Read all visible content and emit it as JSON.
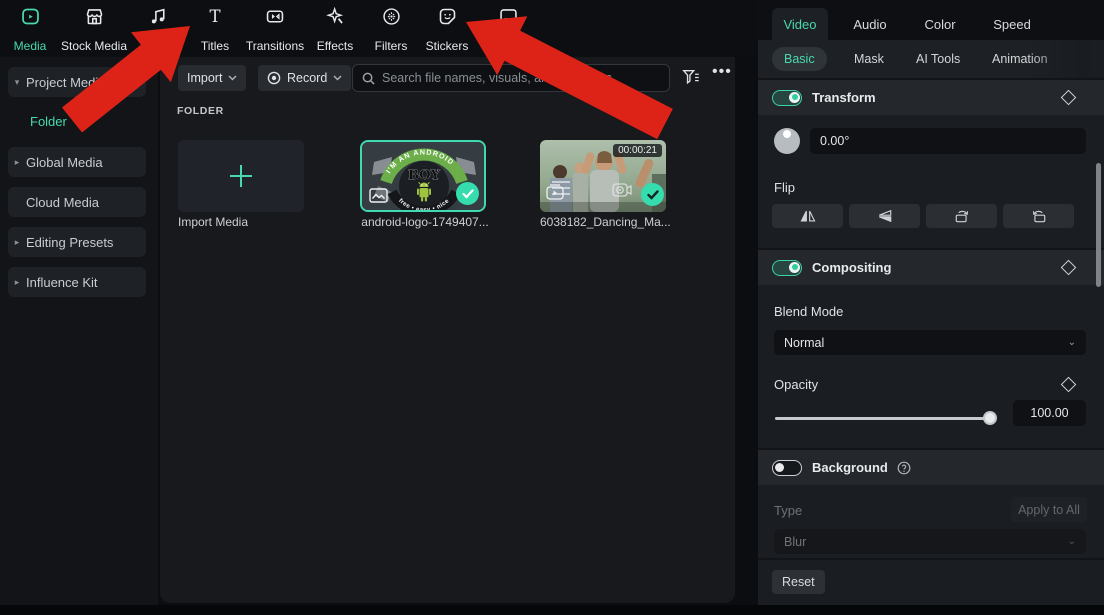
{
  "accent_color": "#49d9ae",
  "arrow_color": "#dd2317",
  "top_tabs": [
    {
      "label": "Media",
      "icon": "media-icon",
      "active": true
    },
    {
      "label": "Stock Media",
      "icon": "stock-media-icon"
    },
    {
      "label": "Audio",
      "icon": "audio-icon"
    },
    {
      "label": "Titles",
      "icon": "titles-icon"
    },
    {
      "label": "Transitions",
      "icon": "transitions-icon"
    },
    {
      "label": "Effects",
      "icon": "effects-icon"
    },
    {
      "label": "Filters",
      "icon": "filters-icon"
    },
    {
      "label": "Stickers",
      "icon": "stickers-icon"
    },
    {
      "label": "Templates",
      "icon": "templates-icon"
    }
  ],
  "sidebar": {
    "items": [
      {
        "label": "Project Media",
        "caret": "▾"
      },
      {
        "label": "Folder",
        "selected": true
      },
      {
        "label": "Global Media",
        "caret": "▸"
      },
      {
        "label": "Cloud Media",
        "caret": ""
      },
      {
        "label": "Editing Presets",
        "caret": "▸"
      },
      {
        "label": "Influence Kit",
        "caret": "▸"
      }
    ]
  },
  "toolbar": {
    "import_label": "Import",
    "record_label": "Record",
    "search_placeholder": "Search file names, visuals, and dialogues"
  },
  "content": {
    "section_label": "FOLDER",
    "import_tile_label": "Import Media",
    "items": [
      {
        "name": "android-logo-1749407...",
        "type": "image",
        "selected": true,
        "logo_text_top": "I'M AN ANDROID",
        "logo_text_center": "BOY",
        "logo_text_bottom": "free • easy • nice"
      },
      {
        "name": "6038182_Dancing_Ma...",
        "type": "video",
        "duration": "00:00:21"
      }
    ]
  },
  "inspector": {
    "tabs": {
      "video": "Video",
      "audio": "Audio",
      "color": "Color",
      "speed": "Speed"
    },
    "active_tab": "Video",
    "subtabs": {
      "basic": "Basic",
      "mask": "Mask",
      "ai_tools": "AI Tools",
      "animation": "Animation"
    },
    "active_subtab": "Basic",
    "transform": {
      "label": "Transform",
      "enabled": true,
      "rotate_value": "0.00°",
      "flip_label": "Flip"
    },
    "compositing": {
      "label": "Compositing",
      "enabled": true,
      "blend_mode_label": "Blend Mode",
      "blend_mode_value": "Normal",
      "opacity_label": "Opacity",
      "opacity_value": "100.00",
      "opacity_percent": 100
    },
    "background": {
      "label": "Background",
      "enabled": false,
      "type_label": "Type",
      "apply_all_label": "Apply to All",
      "type_value": "Blur"
    },
    "reset_label": "Reset"
  }
}
